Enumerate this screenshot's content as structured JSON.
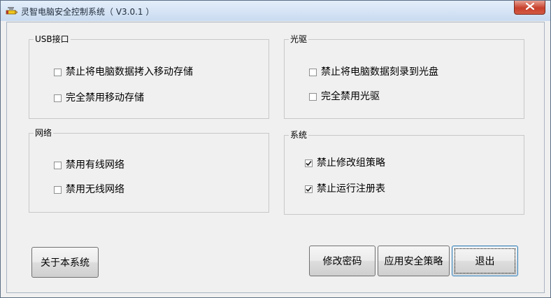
{
  "window": {
    "title": "灵智电脑安全控制系统（ V3.0.1 ）",
    "app_icon": "yellow-pen-icon",
    "close_icon": "close-x-icon"
  },
  "groups": {
    "usb": {
      "title": "USB接口",
      "options": [
        {
          "label": "禁止将电脑数据拷入移动存储",
          "checked": false
        },
        {
          "label": "完全禁用移动存储",
          "checked": false
        }
      ]
    },
    "optical": {
      "title": "光驱",
      "options": [
        {
          "label": "禁止将电脑数据刻录到光盘",
          "checked": false
        },
        {
          "label": "完全禁用光驱",
          "checked": false
        }
      ]
    },
    "network": {
      "title": "网络",
      "options": [
        {
          "label": "禁用有线网络",
          "checked": false
        },
        {
          "label": "禁用无线网络",
          "checked": false
        }
      ]
    },
    "system": {
      "title": "系统",
      "options": [
        {
          "label": "禁止修改组策略",
          "checked": true
        },
        {
          "label": "禁止运行注册表",
          "checked": true
        }
      ]
    }
  },
  "buttons": {
    "about": "关于本系统",
    "change_password": "修改密码",
    "apply_policy": "应用安全策略",
    "exit": "退出"
  }
}
